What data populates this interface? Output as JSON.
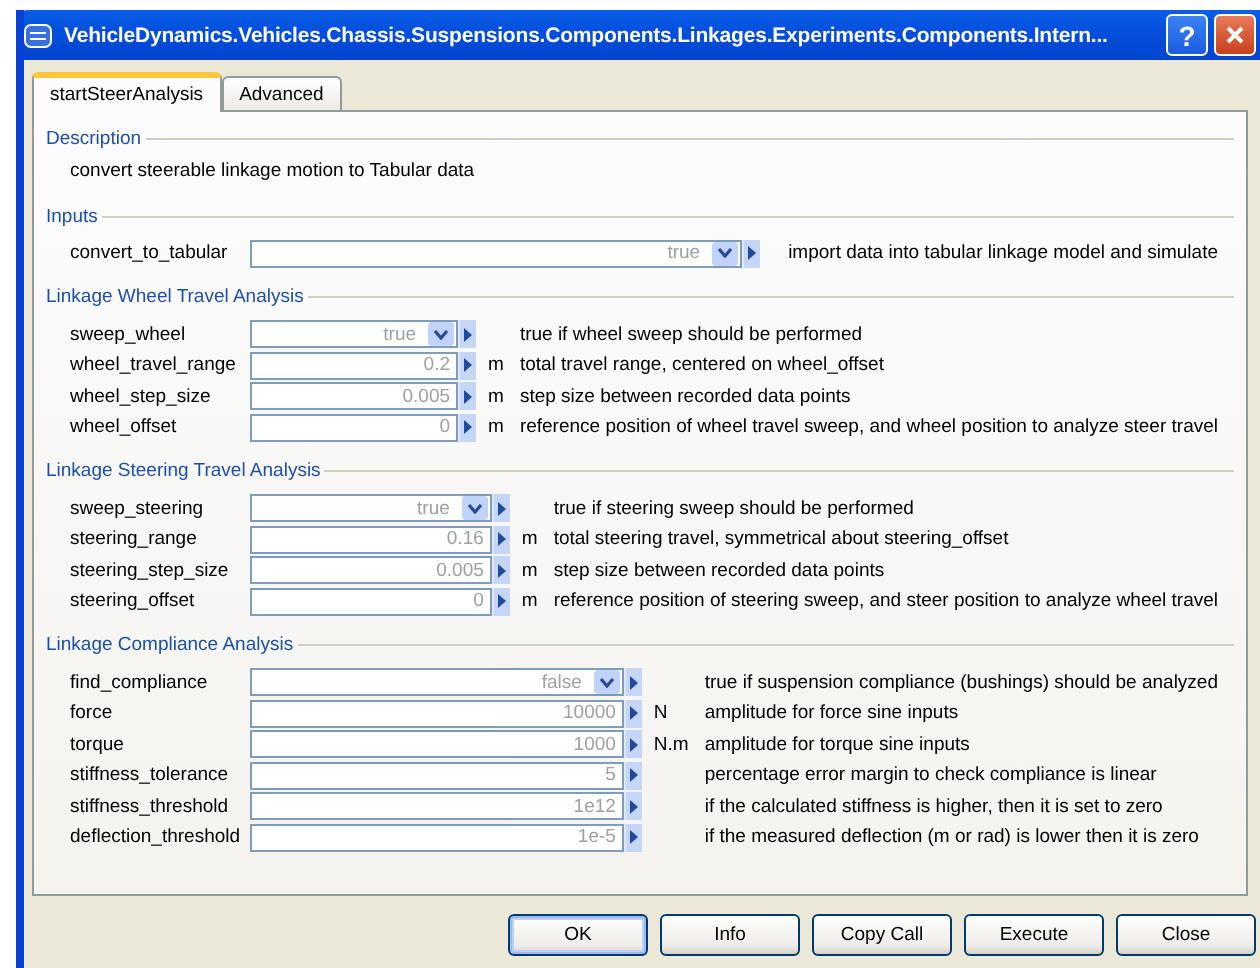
{
  "window": {
    "title": "VehicleDynamics.Vehicles.Chassis.Suspensions.Components.Linkages.Experiments.Components.Intern...",
    "help_label": "?"
  },
  "tabs": [
    {
      "label": "startSteerAnalysis",
      "selected": true
    },
    {
      "label": "Advanced",
      "selected": false
    }
  ],
  "description": {
    "heading": "Description",
    "text": "convert steerable linkage motion to Tabular data"
  },
  "sections": [
    {
      "heading": "Inputs",
      "params": [
        {
          "name": "convert_to_tabular",
          "kind": "combo",
          "value": "true",
          "description": "import data into tabular linkage model and simulate"
        }
      ]
    },
    {
      "heading": "Linkage Wheel Travel Analysis",
      "params": [
        {
          "name": "sweep_wheel",
          "kind": "combo",
          "value": "true",
          "description": "true if wheel sweep should be performed"
        },
        {
          "name": "wheel_travel_range",
          "kind": "number",
          "value": "0.2",
          "unit": "m",
          "description": "total travel range, centered on wheel_offset"
        },
        {
          "name": "wheel_step_size",
          "kind": "number",
          "value": "0.005",
          "unit": "m",
          "description": "step size between recorded data points"
        },
        {
          "name": "wheel_offset",
          "kind": "number",
          "value": "0",
          "unit": "m",
          "description": "reference position of wheel travel sweep, and wheel position to analyze steer travel"
        }
      ]
    },
    {
      "heading": "Linkage Steering Travel Analysis",
      "params": [
        {
          "name": "sweep_steering",
          "kind": "combo",
          "value": "true",
          "description": "true if steering sweep should be performed"
        },
        {
          "name": "steering_range",
          "kind": "number",
          "value": "0.16",
          "unit": "m",
          "description": "total steering travel, symmetrical about steering_offset"
        },
        {
          "name": "steering_step_size",
          "kind": "number",
          "value": "0.005",
          "unit": "m",
          "description": "step size between recorded data points"
        },
        {
          "name": "steering_offset",
          "kind": "number",
          "value": "0",
          "unit": "m",
          "description": "reference position of steering sweep, and steer position to analyze wheel travel"
        }
      ]
    },
    {
      "heading": "Linkage Compliance Analysis",
      "params": [
        {
          "name": "find_compliance",
          "kind": "combo",
          "value": "false",
          "description": "true if suspension compliance (bushings) should be analyzed"
        },
        {
          "name": "force",
          "kind": "number",
          "value": "10000",
          "unit": "N",
          "description": "amplitude for force sine inputs"
        },
        {
          "name": "torque",
          "kind": "number",
          "value": "1000",
          "unit": "N.m",
          "description": "amplitude for torque sine inputs"
        },
        {
          "name": "stiffness_tolerance",
          "kind": "number",
          "value": "5",
          "description": "percentage error margin to check compliance is linear"
        },
        {
          "name": "stiffness_threshold",
          "kind": "number",
          "value": "1e12",
          "description": "if the calculated stiffness is higher, then it is set to zero"
        },
        {
          "name": "deflection_threshold",
          "kind": "number",
          "value": "1e-5",
          "description": "if the measured deflection (m or rad) is lower then it is zero"
        }
      ]
    }
  ],
  "buttons": [
    {
      "label": "OK",
      "default": true
    },
    {
      "label": "Info",
      "default": false
    },
    {
      "label": "Copy Call",
      "default": false
    },
    {
      "label": "Execute",
      "default": false
    },
    {
      "label": "Close",
      "default": false
    }
  ]
}
